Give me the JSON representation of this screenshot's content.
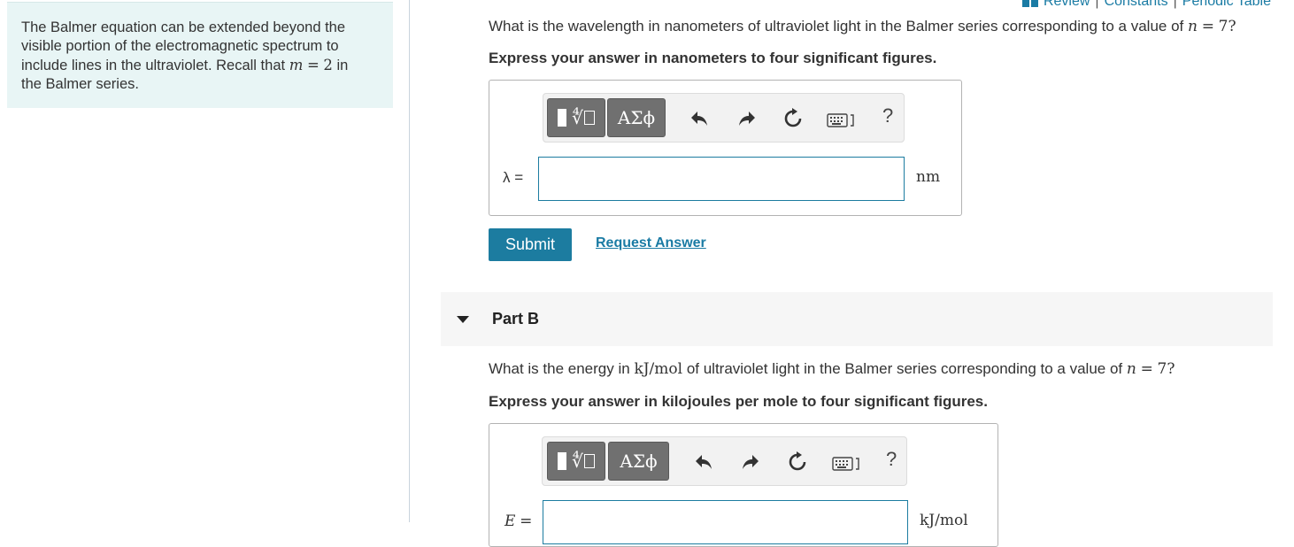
{
  "sidebar": {
    "info_line1": "The Balmer equation can be extended beyond the",
    "info_line2": "visible portion of the electromagnetic spectrum to",
    "info_line3_prefix": "include lines in the ultraviolet. Recall that",
    "info_var_m": "m",
    "info_eq": "=",
    "info_m_value": "2",
    "info_line3_suffix": "in",
    "info_line4": "the Balmer series."
  },
  "top_links": {
    "review": "Review",
    "constants": "Constants",
    "periodic_table": "Periodic Table",
    "separator": "|"
  },
  "part_a": {
    "question_prefix": "What is the wavelength in nanometers of ultraviolet light in the Balmer series corresponding to a value of",
    "var_n": "n",
    "eq": "=",
    "n_value": "7",
    "qmark": "?",
    "instruction": "Express your answer in nanometers to four significant figures.",
    "label": "λ =",
    "input_value": "",
    "unit": "nm",
    "submit_label": "Submit",
    "request_label": "Request Answer"
  },
  "toolbar": {
    "symbols_label": "ΑΣϕ",
    "help_label": "?"
  },
  "part_b": {
    "title": "Part B",
    "question_prefix": "What is the energy in",
    "unit_inline": "kJ/mol",
    "question_mid": "of ultraviolet light in the Balmer series corresponding to a value of",
    "var_n": "n",
    "eq": "=",
    "n_value": "7",
    "qmark": "?",
    "instruction": "Express your answer in kilojoules per mole to four significant figures.",
    "label_var": "E",
    "label_eq": "=",
    "input_value": "",
    "unit": "kJ/mol"
  },
  "colors": {
    "accent": "#1c7ca0",
    "info_bg": "#e8f5f5",
    "toolbar_btn": "#707070"
  }
}
